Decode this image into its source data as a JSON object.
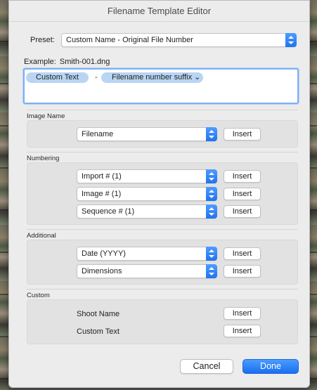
{
  "window": {
    "title": "Filename Template Editor"
  },
  "preset": {
    "label": "Preset:",
    "value": "Custom Name - Original File Number"
  },
  "example": {
    "label": "Example:",
    "value": "Smith-001.dng"
  },
  "template_tokens": [
    {
      "label": "Custom Text"
    },
    {
      "label": "-"
    },
    {
      "label": "Filename number suffix ⌄"
    }
  ],
  "sections": {
    "image_name": {
      "title": "Image Name",
      "rows": [
        {
          "value": "Filename",
          "button": "Insert"
        }
      ]
    },
    "numbering": {
      "title": "Numbering",
      "rows": [
        {
          "value": "Import # (1)",
          "button": "Insert"
        },
        {
          "value": "Image # (1)",
          "button": "Insert"
        },
        {
          "value": "Sequence # (1)",
          "button": "Insert"
        }
      ]
    },
    "additional": {
      "title": "Additional",
      "rows": [
        {
          "value": "Date (YYYY)",
          "button": "Insert"
        },
        {
          "value": "Dimensions",
          "button": "Insert"
        }
      ]
    },
    "custom": {
      "title": "Custom",
      "rows": [
        {
          "label": "Shoot Name",
          "button": "Insert"
        },
        {
          "label": "Custom Text",
          "button": "Insert"
        }
      ]
    }
  },
  "footer": {
    "cancel": "Cancel",
    "done": "Done"
  },
  "colors": {
    "accent": "#1f73f0",
    "token": "#b9d5f3",
    "focus_ring": "#7cb1f5"
  }
}
